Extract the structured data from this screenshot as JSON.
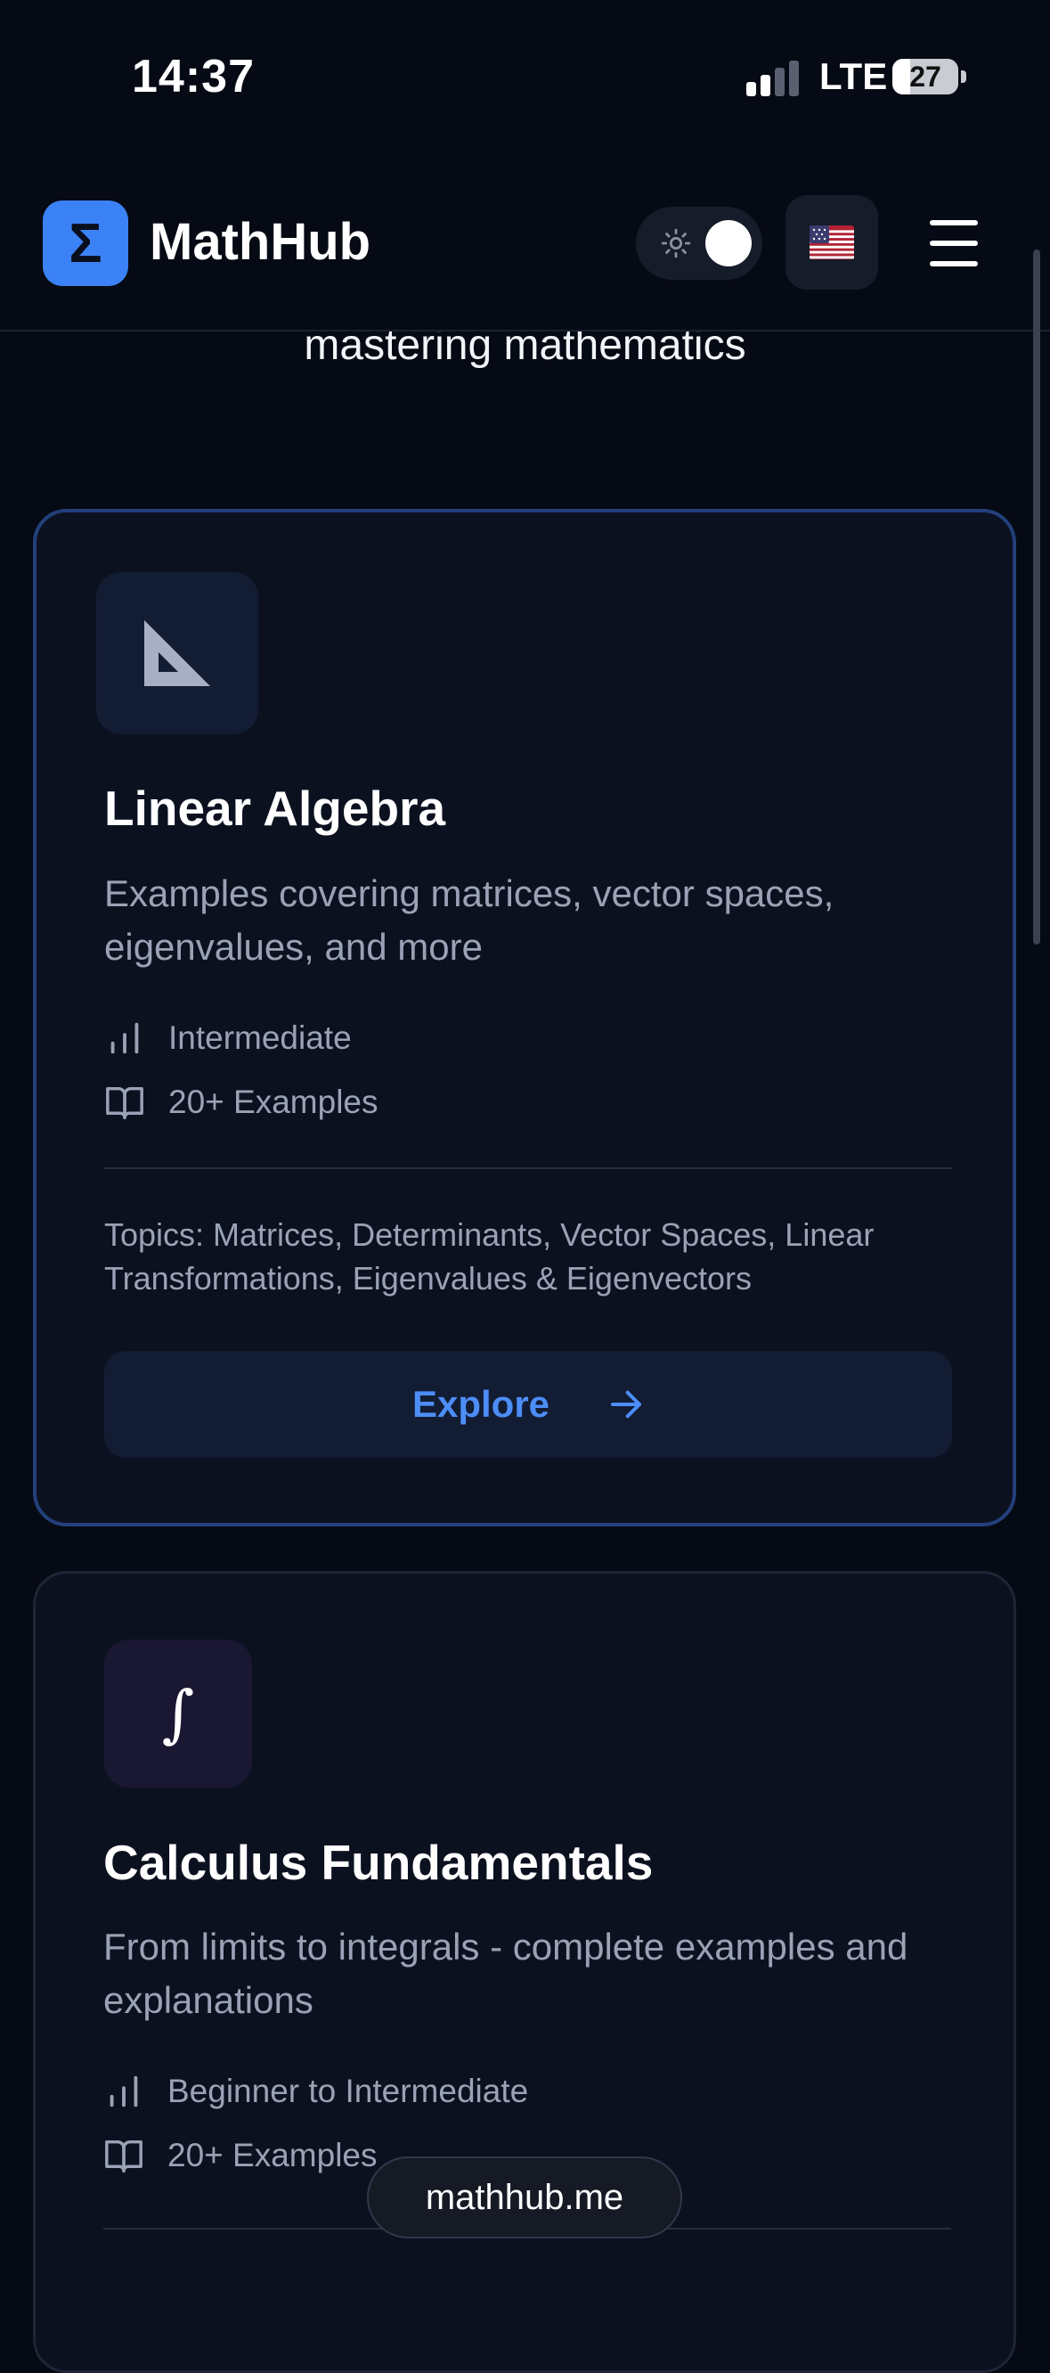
{
  "status_bar": {
    "time": "14:37",
    "network": "LTE",
    "battery_level": "27",
    "battery_fraction": 0.27
  },
  "header": {
    "logo_symbol": "Σ",
    "brand": "MathHub",
    "theme_toggle_icon": "sun-icon",
    "language_flag": "us-flag",
    "menu_icon": "hamburger-icon"
  },
  "hero": {
    "subtitle": "mastering mathematics"
  },
  "courses": [
    {
      "icon": "set-square-icon",
      "title": "Linear Algebra",
      "description": "Examples covering matrices, vector spaces, eigenvalues, and more",
      "level": "Intermediate",
      "examples": "20+ Examples",
      "topics": "Topics: Matrices, Determinants, Vector Spaces, Linear Transformations, Eigenvalues & Eigenvectors",
      "cta": "Explore"
    },
    {
      "icon_symbol": "∫",
      "title": "Calculus Fundamentals",
      "description": "From limits to integrals - complete examples and explanations",
      "level": "Beginner to Intermediate",
      "examples": "20+ Examples"
    }
  ],
  "browser": {
    "url": "mathhub.me"
  },
  "colors": {
    "background": "#060a14",
    "card": "#0c1120",
    "accent": "#3b82f6",
    "active_border": "#22407a",
    "muted_text": "#9aa3b5"
  }
}
